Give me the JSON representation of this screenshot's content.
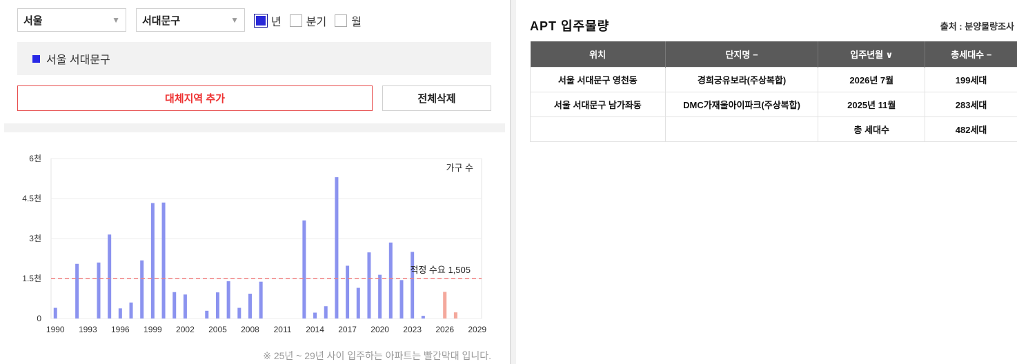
{
  "filters": {
    "region": "서울",
    "district": "서대문구",
    "periods": [
      {
        "label": "년",
        "checked": true
      },
      {
        "label": "분기",
        "checked": false
      },
      {
        "label": "월",
        "checked": false
      }
    ]
  },
  "legend": {
    "label": "서울 서대문구",
    "color": "#2828e6"
  },
  "buttons": {
    "add_region": "대체지역 추가",
    "clear_all": "전체삭제"
  },
  "chart_data": {
    "type": "bar",
    "ylabel_in_plot": "가구 수",
    "ylim": [
      0,
      6000
    ],
    "y_ticks": [
      {
        "value": 0,
        "label": "0"
      },
      {
        "value": 1500,
        "label": "1.5천"
      },
      {
        "value": 3000,
        "label": "3천"
      },
      {
        "value": 4500,
        "label": "4.5천"
      },
      {
        "value": 6000,
        "label": "6천"
      }
    ],
    "x_ticks": [
      1990,
      1993,
      1996,
      1999,
      2002,
      2005,
      2008,
      2011,
      2014,
      2017,
      2020,
      2023,
      2026,
      2029
    ],
    "xlim": [
      1989.6,
      2029.4
    ],
    "grid": true,
    "series_color": "#8b93ef",
    "future_color": "#f4a89c",
    "reference_line": {
      "value": 1505,
      "label": "적정 수요 1,505",
      "color": "#f08080"
    },
    "bars": [
      {
        "year": 1990,
        "value": 400
      },
      {
        "year": 1992,
        "value": 2050
      },
      {
        "year": 1994,
        "value": 2100
      },
      {
        "year": 1995,
        "value": 3150
      },
      {
        "year": 1996,
        "value": 380
      },
      {
        "year": 1997,
        "value": 600
      },
      {
        "year": 1998,
        "value": 2180
      },
      {
        "year": 1999,
        "value": 4330
      },
      {
        "year": 2000,
        "value": 4350
      },
      {
        "year": 2001,
        "value": 990
      },
      {
        "year": 2002,
        "value": 900
      },
      {
        "year": 2004,
        "value": 290
      },
      {
        "year": 2005,
        "value": 980
      },
      {
        "year": 2006,
        "value": 1400
      },
      {
        "year": 2007,
        "value": 400
      },
      {
        "year": 2008,
        "value": 930
      },
      {
        "year": 2009,
        "value": 1380
      },
      {
        "year": 2013,
        "value": 3680
      },
      {
        "year": 2014,
        "value": 220
      },
      {
        "year": 2015,
        "value": 460
      },
      {
        "year": 2016,
        "value": 5300
      },
      {
        "year": 2017,
        "value": 1980
      },
      {
        "year": 2018,
        "value": 1150
      },
      {
        "year": 2019,
        "value": 2480
      },
      {
        "year": 2020,
        "value": 1640
      },
      {
        "year": 2021,
        "value": 2850
      },
      {
        "year": 2022,
        "value": 1440
      },
      {
        "year": 2023,
        "value": 2500
      },
      {
        "year": 2024,
        "value": 100
      },
      {
        "year": 2026,
        "value": 1000,
        "future": true
      },
      {
        "year": 2027,
        "value": 230,
        "future": true
      }
    ]
  },
  "chart_note": "※ 25년 ~ 29년 사이 입주하는 아파트는 빨간막대 입니다.",
  "supply": {
    "title": "APT 입주물량",
    "source": "출처 : 분양물량조사",
    "columns": [
      "위치",
      "단지명 −",
      "입주년월 ∨",
      "총세대수 −"
    ],
    "rows": [
      [
        "서울 서대문구 영천동",
        "경희궁유보라(주상복합)",
        "2026년 7월",
        "199세대"
      ],
      [
        "서울 서대문구 남가좌동",
        "DMC가재울아이파크(주상복합)",
        "2025년 11월",
        "283세대"
      ]
    ],
    "total": {
      "label": "총 세대수",
      "value": "482세대"
    }
  }
}
